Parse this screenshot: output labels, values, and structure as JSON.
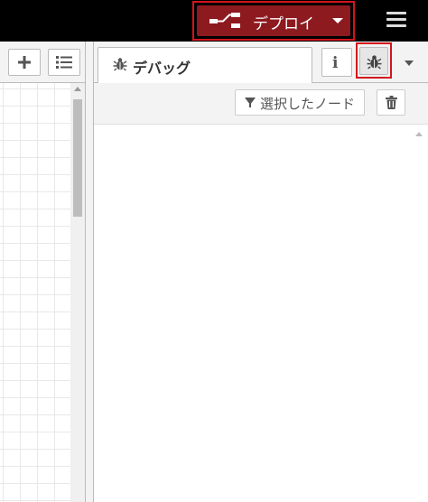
{
  "header": {
    "deploy": {
      "label": "デプロイ",
      "icon": "deploy-flow-icon",
      "highlight_color": "#d3141c",
      "button_color": "#8c1a1f"
    },
    "menu": {
      "icon": "hamburger-menu-icon"
    }
  },
  "workspace": {
    "add_icon": "plus-icon",
    "list_icon": "list-icon"
  },
  "sidebar": {
    "tab": {
      "label": "デバッグ",
      "icon": "bug-icon"
    },
    "info_icon": "info-icon",
    "debug_icon": "bug-icon",
    "dropdown_icon": "caret-down-icon",
    "debug_panel": {
      "filter_label": "選択したノード",
      "filter_icon": "filter-icon",
      "clear_icon": "trash-icon"
    }
  }
}
